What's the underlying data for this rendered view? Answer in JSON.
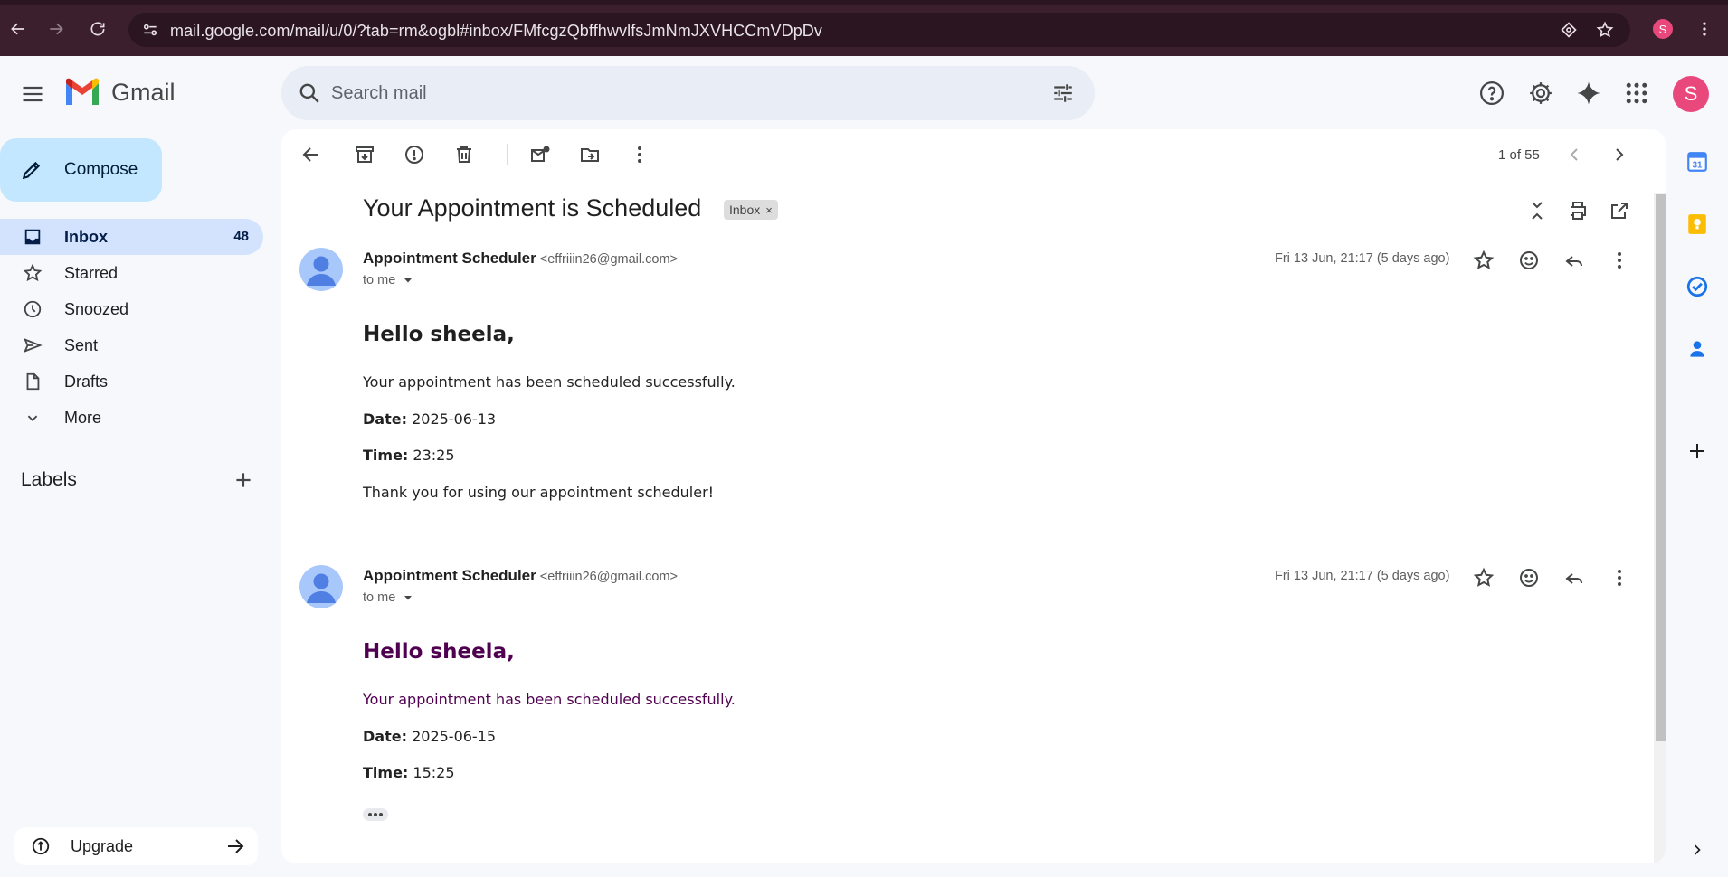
{
  "browser": {
    "url": "mail.google.com/mail/u/0/?tab=rm&ogbl#inbox/FMfcgzQbffhwvlfsJmNmJXVHCCmVDpDv",
    "profile_initial": "S"
  },
  "header": {
    "app_name": "Gmail",
    "search_placeholder": "Search mail",
    "avatar_initial": "S"
  },
  "sidebar": {
    "compose_label": "Compose",
    "items": [
      {
        "label": "Inbox",
        "count": "48",
        "icon": "inbox-icon",
        "active": true
      },
      {
        "label": "Starred",
        "count": "",
        "icon": "star-icon",
        "active": false
      },
      {
        "label": "Snoozed",
        "count": "",
        "icon": "clock-icon",
        "active": false
      },
      {
        "label": "Sent",
        "count": "",
        "icon": "send-icon",
        "active": false
      },
      {
        "label": "Drafts",
        "count": "",
        "icon": "draft-icon",
        "active": false
      },
      {
        "label": "More",
        "count": "",
        "icon": "chevron-down-icon",
        "active": false
      }
    ],
    "labels_title": "Labels",
    "upgrade_label": "Upgrade"
  },
  "toolbar": {
    "pager": "1 of 55"
  },
  "thread": {
    "subject": "Your Appointment is Scheduled",
    "label_chip": "Inbox",
    "label_chip_close": "×",
    "messages": [
      {
        "sender_name": "Appointment Scheduler",
        "sender_email": "<effriiin26@gmail.com>",
        "to": "to me",
        "date": "Fri 13 Jun, 21:17 (5 days ago)",
        "greeting": "Hello sheela,",
        "line1": "Your appointment has been scheduled successfully.",
        "date_label": "Date:",
        "date_value": "2025-06-13",
        "time_label": "Time:",
        "time_value": "23:25",
        "closing": "Thank you for using our appointment scheduler!"
      },
      {
        "sender_name": "Appointment Scheduler",
        "sender_email": "<effriiin26@gmail.com>",
        "to": "to me",
        "date": "Fri 13 Jun, 21:17 (5 days ago)",
        "greeting": "Hello sheela,",
        "line1": "Your appointment has been scheduled successfully.",
        "date_label": "Date:",
        "date_value": "2025-06-15",
        "time_label": "Time:",
        "time_value": "15:25"
      }
    ]
  },
  "colors": {
    "accent": "#c2e7ff",
    "active_nav": "#d3e3fd",
    "quoted_text": "#500050",
    "avatar": "#e8487c"
  }
}
